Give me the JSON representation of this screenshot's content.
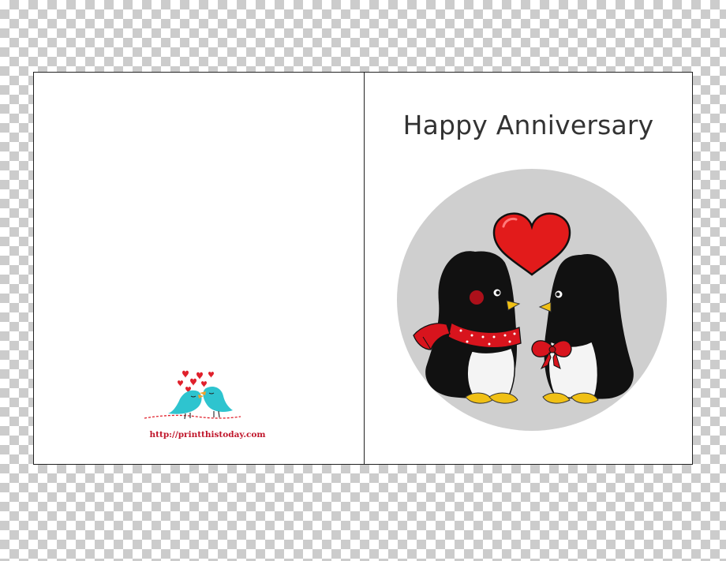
{
  "card": {
    "title": "Happy Anniversary",
    "website": "http://printthistoday.com"
  },
  "icons": {
    "main_art": "penguin-couple-heart-icon",
    "logo": "lovebirds-icon"
  },
  "colors": {
    "background_circle": "#cfcfcf",
    "heart": "#e21b1b",
    "bird": "#2ec4cf",
    "url_text": "#c0162b",
    "title_text": "#333333"
  }
}
